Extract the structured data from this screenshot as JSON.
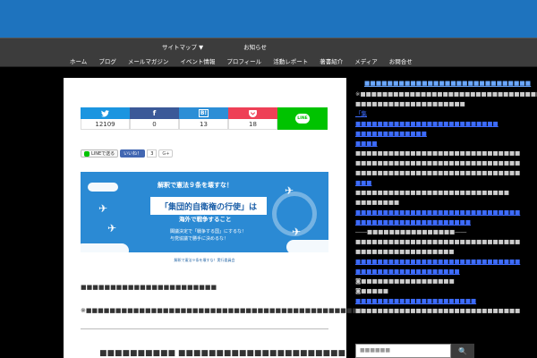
{
  "nav": {
    "row1": [
      "サイトマップ ▼",
      "お知らせ"
    ],
    "row2": [
      "ホーム",
      "ブログ",
      "メールマガジン",
      "イベント情報",
      "プロフィール",
      "活動レポート",
      "著書紹介",
      "メディア",
      "お問合せ"
    ]
  },
  "share": {
    "twitter": {
      "icon": "twitter-icon",
      "count": "12109"
    },
    "facebook": {
      "icon": "facebook-icon",
      "count": "0"
    },
    "hatena": {
      "icon": "hatena-icon",
      "count": "13"
    },
    "pocket": {
      "icon": "pocket-icon",
      "count": "18"
    },
    "line": {
      "label": "LINE"
    }
  },
  "mini": {
    "line": "LINEで送る",
    "fb": "いいね！",
    "fb_count": "3",
    "gplus": "G+"
  },
  "banner": {
    "line1": "解釈で憲法９条を壊すな！",
    "box": "「集団的自衛権の行使」は",
    "line3": "海外で戦争すること",
    "line4a": "閣議決定で「戦争する国」にするな！",
    "line4b": "与党協議で勝手に決めるな！",
    "footer": "解釈で憲法９条を壊すな！実行委員会"
  },
  "body": {
    "p1": "■■■■■■■■■■■■■■■■■■■■■■■",
    "p2": "※■■■■■■■■■■■■■■■■■■■■■■■■■■■■■■■■■■■■■■■■■■■■■■■",
    "headline": "■■■■■■■■■■ ■■■■■■■■■■■■■■■■■■■■■■"
  },
  "sidebar": {
    "title": "■■■■■■■■■■■■■■■■■■■■■■■■■■■■■",
    "items": [
      {
        "type": "t",
        "text": "※■■■■■■■■■■■■■■■■■■■■■■■■■■■■■■■■■■"
      },
      {
        "type": "t",
        "text": "■■■■■■■■■■■■■■■■■■■■"
      },
      {
        "type": "a",
        "text": "「集■■■■■■■■■■■■■■■■■■■■■■■■■■"
      },
      {
        "type": "a",
        "text": "■■■■■■■■■■■■■"
      },
      {
        "type": "a",
        "text": "■■■■"
      },
      {
        "type": "t",
        "text": "■■■■■■■■■■■■■■■■■■■■■■■■■■■■■■"
      },
      {
        "type": "t",
        "text": "■■■■■■■■■■■■■■■■■■■■■■■■■■■■■■"
      },
      {
        "type": "t",
        "text": "■■■■■■■■■■■■■■■■■■■■■■■■■■■■■■"
      },
      {
        "type": "a",
        "text": "■■■"
      },
      {
        "type": "t",
        "text": "■■■■■■■■■■■■■■■■■■■■■■■■■■■■"
      },
      {
        "type": "t",
        "text": "■■■■■■■■"
      },
      {
        "type": "a",
        "text": "■■■■■■■■■■■■■■■■■■■■■■■■■■■■■■"
      },
      {
        "type": "a",
        "text": "■■■■■■■■■■■■■■■■■■■■■"
      },
      {
        "type": "t",
        "text": "――■■■■■■■■■■■■■■■■――"
      },
      {
        "type": "t",
        "text": "■■■■■■■■■■■■■■■■■■■■■■■■■■■■■■"
      },
      {
        "type": "t",
        "text": "■■■■■■■■■■■■■■■■■■"
      },
      {
        "type": "a",
        "text": "■■■■■■■■■■■■■■■■■■■■■■■■■■■■■■"
      },
      {
        "type": "a",
        "text": "■■■■■■■■■■■■■■■■■■■"
      },
      {
        "type": "t",
        "text": "◙■■■■■■■■■■■■■■■■■"
      },
      {
        "type": "t",
        "text": "◙■■■■■"
      },
      {
        "type": "a",
        "text": "■■■■■■■■■■■■■■■■■■■■■■"
      },
      {
        "type": "t",
        "text": "■■■■■■■■■■■■■■■■■■■■■■■■■■■■■■"
      }
    ]
  },
  "search": {
    "placeholder": "■■■■■■",
    "icon": "search-icon"
  }
}
